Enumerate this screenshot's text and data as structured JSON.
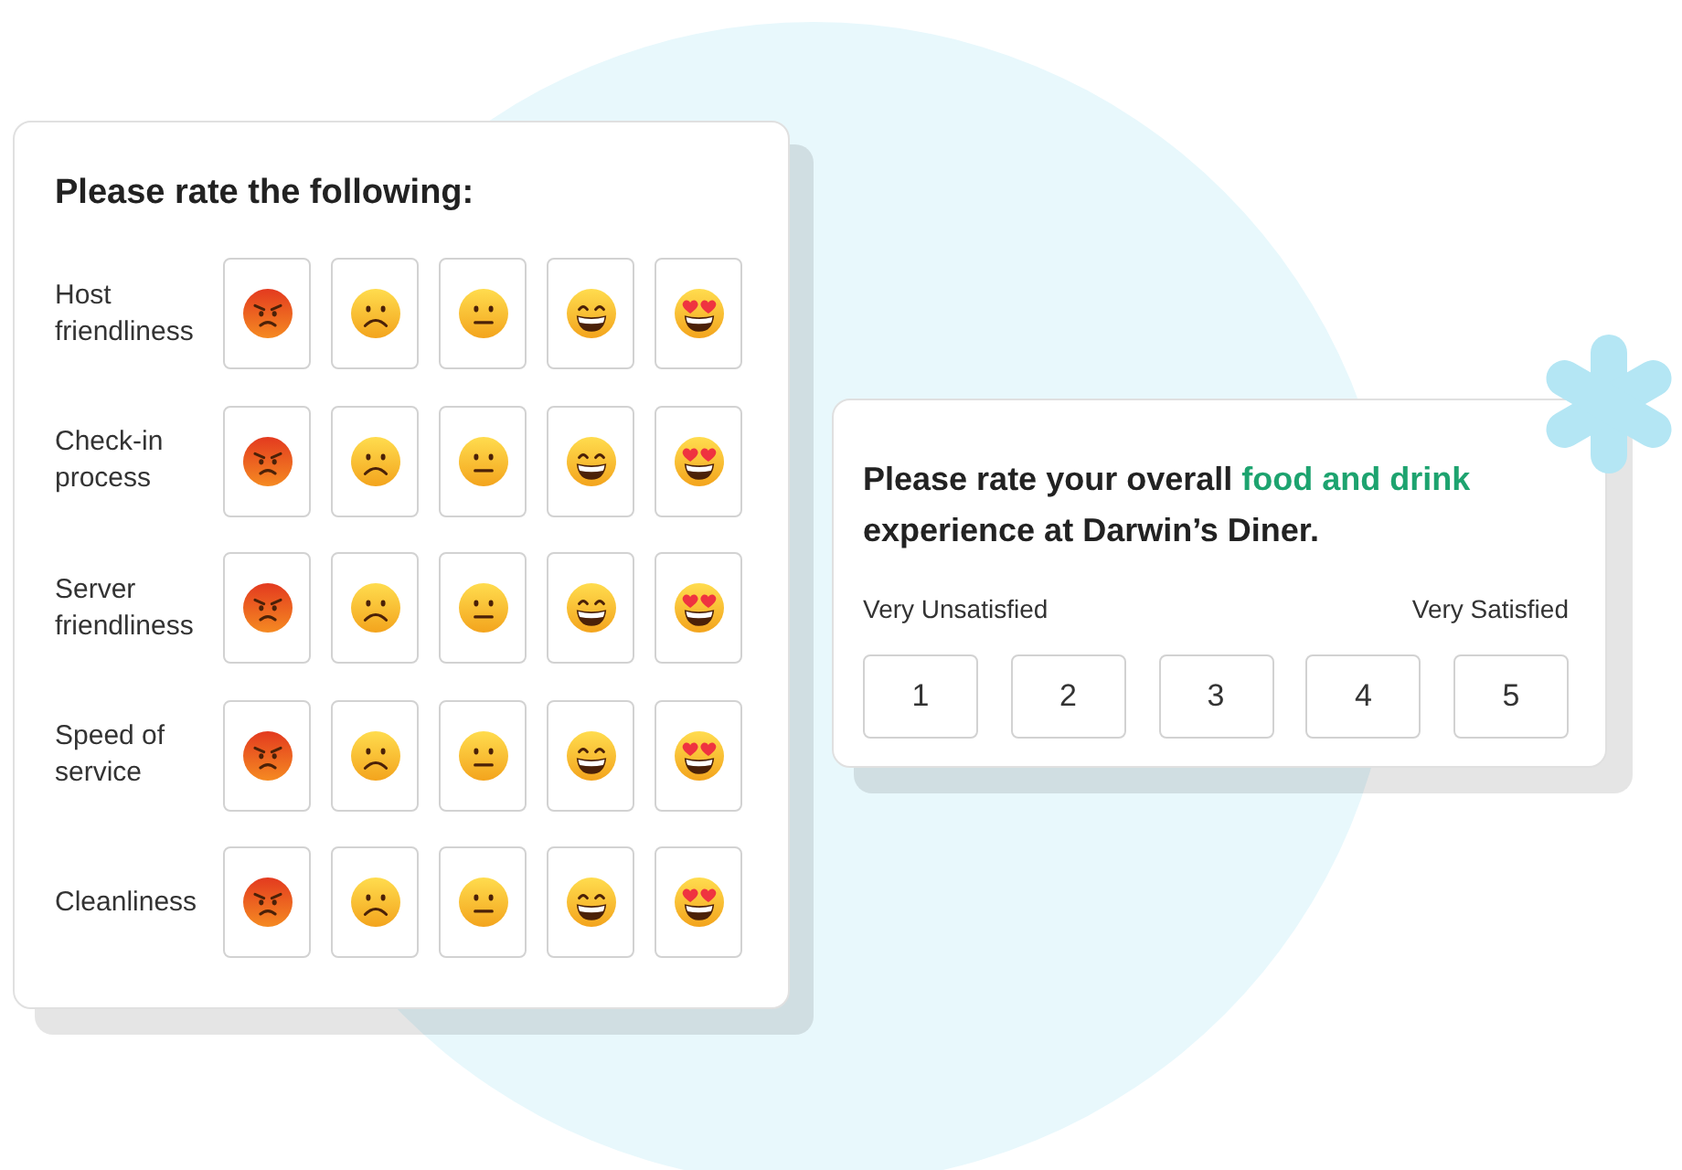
{
  "rating_grid": {
    "title": "Please rate the following:",
    "rows": [
      {
        "label": "Host friendliness"
      },
      {
        "label": "Check-in process"
      },
      {
        "label": "Server friendliness"
      },
      {
        "label": "Speed of service"
      },
      {
        "label": "Cleanliness"
      }
    ]
  },
  "overall_rating": {
    "question": [
      {
        "text": "Please rate your overall ",
        "highlighted": false
      },
      {
        "text": "food and drink",
        "highlighted": true
      },
      {
        "text": " experience at Darwin’s Diner.",
        "highlighted": false
      }
    ],
    "low_label": "Very Unsatisfied",
    "high_label": "Very Satisfied",
    "options": [
      {
        "label": "1",
        "selected": false
      },
      {
        "label": "2",
        "selected": false
      },
      {
        "label": "3",
        "selected": false
      },
      {
        "label": "4",
        "selected": false
      },
      {
        "label": "5",
        "selected": false
      }
    ]
  }
}
